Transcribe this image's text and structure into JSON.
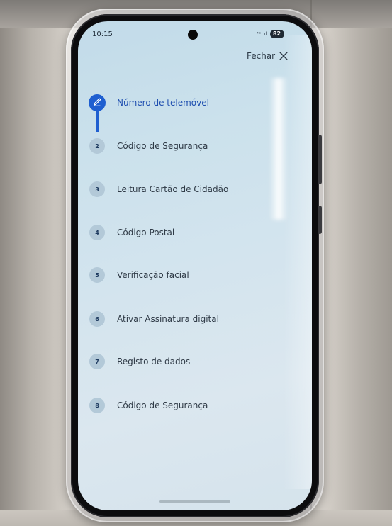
{
  "status_bar": {
    "time": "10:15",
    "battery": "82",
    "signal_icons": "⁴ᴳ .ıl"
  },
  "header": {
    "close_label": "Fechar"
  },
  "stepper": {
    "active_color": "#1f5fd0",
    "steps": [
      {
        "number": "1",
        "label": "Número de telemóvel",
        "state": "active",
        "icon": "pencil-icon"
      },
      {
        "number": "2",
        "label": "Código de Segurança",
        "state": "pending"
      },
      {
        "number": "3",
        "label": "Leitura Cartão de Cidadão",
        "state": "pending"
      },
      {
        "number": "4",
        "label": "Código Postal",
        "state": "pending"
      },
      {
        "number": "5",
        "label": "Verificação facial",
        "state": "pending"
      },
      {
        "number": "6",
        "label": "Ativar Assinatura digital",
        "state": "pending"
      },
      {
        "number": "7",
        "label": "Registo de dados",
        "state": "pending"
      },
      {
        "number": "8",
        "label": "Código de Segurança",
        "state": "pending"
      }
    ]
  }
}
